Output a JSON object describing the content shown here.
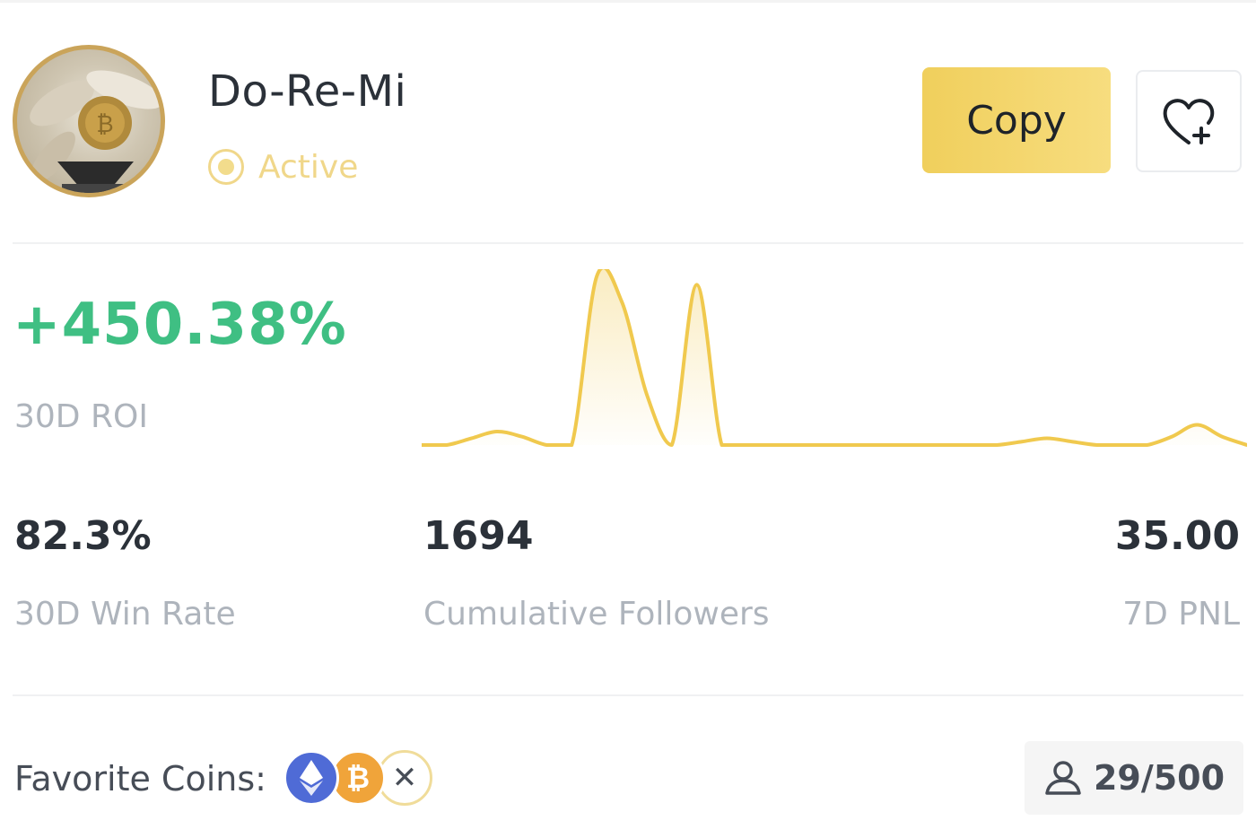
{
  "trader": {
    "name": "Do-Re-Mi",
    "status": "Active",
    "avatar_icon": "trader-avatar"
  },
  "actions": {
    "copy_label": "Copy",
    "favorite_icon": "heart-plus-icon"
  },
  "roi": {
    "value": "+450.38%",
    "label": "30D ROI",
    "color": "#3fbf83"
  },
  "chart_data": {
    "type": "area",
    "color": "#f0c94e",
    "values": [
      0,
      0,
      0.04,
      0.08,
      0.05,
      0,
      0,
      1.0,
      0.85,
      0.3,
      0,
      0.95,
      0.0,
      0,
      0,
      0,
      0,
      0,
      0,
      0,
      0,
      0,
      0,
      0,
      0.02,
      0.04,
      0.02,
      0,
      0,
      0,
      0.05,
      0.12,
      0.05,
      0
    ],
    "grid": false,
    "xlabel": "",
    "ylabel": ""
  },
  "stats": {
    "win_rate": {
      "value": "82.3%",
      "label": "30D Win Rate"
    },
    "followers": {
      "value": "1694",
      "label": "Cumulative Followers"
    },
    "pnl": {
      "value": "35.00",
      "label": "7D PNL"
    }
  },
  "footer": {
    "favorite_coins_label": "Favorite Coins:",
    "coins": [
      "eth-icon",
      "btc-icon",
      "x-icon"
    ],
    "copiers": "29/500",
    "copiers_icon": "user-icon"
  },
  "colors": {
    "accent": "#f0cf5c",
    "status": "#f0d78a",
    "muted": "#aeb4bc"
  }
}
